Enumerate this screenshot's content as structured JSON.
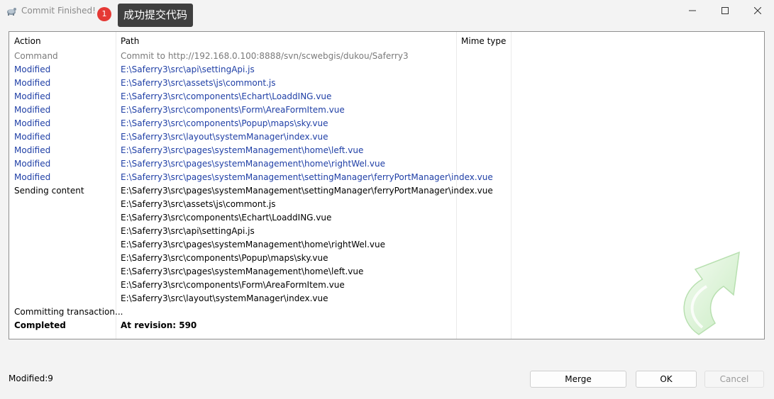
{
  "window": {
    "title": "Commit Finished!",
    "controls": [
      "minimize-icon",
      "maximize-icon",
      "close-icon"
    ]
  },
  "annotation": {
    "step": "1",
    "text": "成功提交代码"
  },
  "list": {
    "headers": {
      "action": "Action",
      "path": "Path",
      "mime": "Mime type"
    },
    "rows": [
      {
        "type": "command",
        "action": "Command",
        "path": "Commit to http://192.168.0.100:8888/svn/scwebgis/dukou/Saferry3"
      },
      {
        "type": "modified",
        "action": "Modified",
        "path": "E:\\Saferry3\\src\\api\\settingApi.js"
      },
      {
        "type": "modified",
        "action": "Modified",
        "path": "E:\\Saferry3\\src\\assets\\js\\commont.js"
      },
      {
        "type": "modified",
        "action": "Modified",
        "path": "E:\\Saferry3\\src\\components\\Echart\\LoaddING.vue"
      },
      {
        "type": "modified",
        "action": "Modified",
        "path": "E:\\Saferry3\\src\\components\\Form\\AreaFormItem.vue"
      },
      {
        "type": "modified",
        "action": "Modified",
        "path": "E:\\Saferry3\\src\\components\\Popup\\maps\\sky.vue"
      },
      {
        "type": "modified",
        "action": "Modified",
        "path": "E:\\Saferry3\\src\\layout\\systemManager\\index.vue"
      },
      {
        "type": "modified",
        "action": "Modified",
        "path": "E:\\Saferry3\\src\\pages\\systemManagement\\home\\left.vue"
      },
      {
        "type": "modified",
        "action": "Modified",
        "path": "E:\\Saferry3\\src\\pages\\systemManagement\\home\\rightWel.vue"
      },
      {
        "type": "modified",
        "action": "Modified",
        "path": "E:\\Saferry3\\src\\pages\\systemManagement\\settingManager\\ferryPortManager\\index.vue"
      },
      {
        "type": "normal",
        "action": "Sending content",
        "path": "E:\\Saferry3\\src\\pages\\systemManagement\\settingManager\\ferryPortManager\\index.vue"
      },
      {
        "type": "normal",
        "action": "",
        "path": "E:\\Saferry3\\src\\assets\\js\\commont.js"
      },
      {
        "type": "normal",
        "action": "",
        "path": "E:\\Saferry3\\src\\components\\Echart\\LoaddING.vue"
      },
      {
        "type": "normal",
        "action": "",
        "path": "E:\\Saferry3\\src\\api\\settingApi.js"
      },
      {
        "type": "normal",
        "action": "",
        "path": "E:\\Saferry3\\src\\pages\\systemManagement\\home\\rightWel.vue"
      },
      {
        "type": "normal",
        "action": "",
        "path": "E:\\Saferry3\\src\\components\\Popup\\maps\\sky.vue"
      },
      {
        "type": "normal",
        "action": "",
        "path": "E:\\Saferry3\\src\\pages\\systemManagement\\home\\left.vue"
      },
      {
        "type": "normal",
        "action": "",
        "path": "E:\\Saferry3\\src\\components\\Form\\AreaFormItem.vue"
      },
      {
        "type": "normal",
        "action": "",
        "path": "E:\\Saferry3\\src\\layout\\systemManager\\index.vue"
      },
      {
        "type": "normal",
        "action": "Committing transaction...",
        "path": ""
      },
      {
        "type": "completed",
        "action": "Completed",
        "path": "At revision: 590"
      }
    ]
  },
  "status": {
    "text": "Modified:9"
  },
  "buttons": {
    "merge": "Merge",
    "ok": "OK",
    "cancel": "Cancel"
  },
  "colors": {
    "modified": "#1f3fa6",
    "command": "#7a7a7a",
    "badge": "#e53935",
    "annotation_bg": "#3f3f3f"
  }
}
